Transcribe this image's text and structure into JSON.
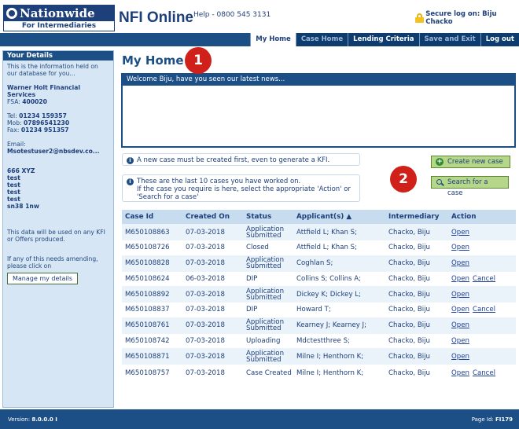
{
  "header": {
    "logo_brand": "Nationwide",
    "logo_sub": "For Intermediaries",
    "app_title": "NFI Online",
    "helpline": "Help - 0800 545 3131",
    "secure_login": "Secure log on: Biju Chacko"
  },
  "nav": {
    "tabs": [
      {
        "label": "My Home",
        "state": "active"
      },
      {
        "label": "Case Home",
        "state": "dim"
      },
      {
        "label": "Lending Criteria",
        "state": "normal"
      },
      {
        "label": "Save and Exit",
        "state": "dim"
      },
      {
        "label": "Log out",
        "state": "normal"
      }
    ]
  },
  "sidebar": {
    "title": "Your Details",
    "intro": "This is the information held on our database for you...",
    "firm_name": "Warner Holt Financial Services",
    "fsa_label": "FSA:",
    "fsa": "400020",
    "tel_label": "Tel:",
    "tel": "01234 159357",
    "mob_label": "Mob:",
    "mob": "07896541230",
    "fax_label": "Fax:",
    "fax": "01234 951357",
    "email_label": "Email:",
    "email": "Msotestuser2@nbsdev.co...",
    "address": [
      "666 XYZ",
      "test",
      "test",
      "test",
      "test",
      "sn38 1nw"
    ],
    "note1": "This data will be used on any KFI or Offers produced.",
    "note2": "If any of this needs amending, please click on",
    "manage_btn": "Manage my details"
  },
  "main": {
    "title": "My Home",
    "news_header": "Welcome Biju, have you seen our latest news...",
    "info_kfi": "A new case must be created first, even to generate a KFI.",
    "info_last10_line1": "These are the last 10 cases you have worked on.",
    "info_last10_line2": "If the case you require is here, select the appropriate 'Action' or 'Search for a case'",
    "create_btn": "Create new case",
    "search_btn": "Search for a case",
    "badges": [
      "1",
      "2"
    ]
  },
  "table": {
    "headers": [
      "Case Id",
      "Created On",
      "Status",
      "Applicant(s) ▲",
      "Intermediary",
      "Action"
    ],
    "rows": [
      {
        "id": "M650108863",
        "date": "07-03-2018",
        "status": "Application Submitted",
        "applicants": "Attfield L; Khan S;",
        "intermediary": "Chacko, Biju",
        "open": "Open",
        "cancel": ""
      },
      {
        "id": "M650108726",
        "date": "07-03-2018",
        "status": "Closed",
        "applicants": "Attfield L; Khan S;",
        "intermediary": "Chacko, Biju",
        "open": "Open",
        "cancel": ""
      },
      {
        "id": "M650108828",
        "date": "07-03-2018",
        "status": "Application Submitted",
        "applicants": "Coghlan S;",
        "intermediary": "Chacko, Biju",
        "open": "Open",
        "cancel": ""
      },
      {
        "id": "M650108624",
        "date": "06-03-2018",
        "status": "DIP",
        "applicants": "Collins S; Collins A;",
        "intermediary": "Chacko, Biju",
        "open": "Open",
        "cancel": "Cancel"
      },
      {
        "id": "M650108892",
        "date": "07-03-2018",
        "status": "Application Submitted",
        "applicants": "Dickey K; Dickey L;",
        "intermediary": "Chacko, Biju",
        "open": "Open",
        "cancel": ""
      },
      {
        "id": "M650108837",
        "date": "07-03-2018",
        "status": "DIP",
        "applicants": "Howard T;",
        "intermediary": "Chacko, Biju",
        "open": "Open",
        "cancel": "Cancel"
      },
      {
        "id": "M650108761",
        "date": "07-03-2018",
        "status": "Application Submitted",
        "applicants": "Kearney J; Kearney J;",
        "intermediary": "Chacko, Biju",
        "open": "Open",
        "cancel": ""
      },
      {
        "id": "M650108742",
        "date": "07-03-2018",
        "status": "Uploading",
        "applicants": "Mdctestthree S;",
        "intermediary": "Chacko, Biju",
        "open": "Open",
        "cancel": ""
      },
      {
        "id": "M650108871",
        "date": "07-03-2018",
        "status": "Application Submitted",
        "applicants": "Milne I; Henthorn K;",
        "intermediary": "Chacko, Biju",
        "open": "Open",
        "cancel": ""
      },
      {
        "id": "M650108757",
        "date": "07-03-2018",
        "status": "Case Created",
        "applicants": "Milne I; Henthorn K;",
        "intermediary": "Chacko, Biju",
        "open": "Open",
        "cancel": "Cancel"
      }
    ]
  },
  "footer": {
    "version_label": "Version:",
    "version": "8.0.0.0 I",
    "page_label": "Page Id:",
    "page_id": "FI179"
  }
}
